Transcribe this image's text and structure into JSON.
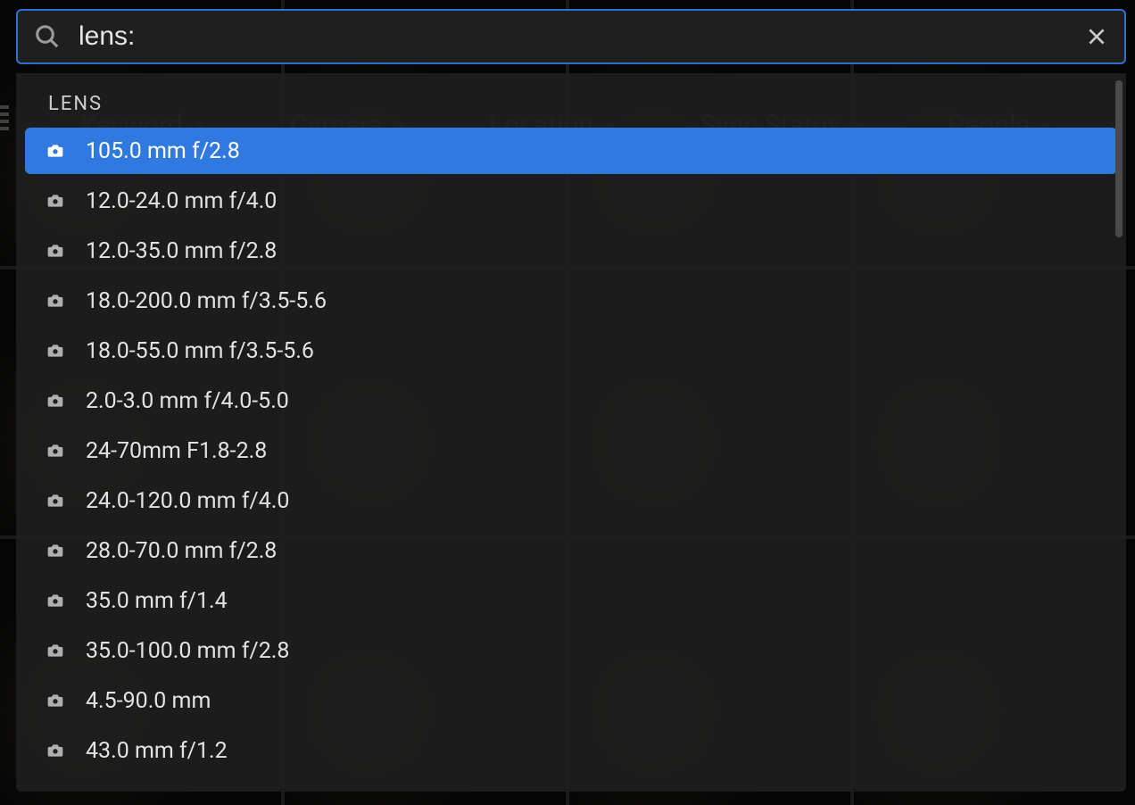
{
  "search": {
    "value": "lens:",
    "placeholder": "Search"
  },
  "filters": [
    {
      "label": "Keyword"
    },
    {
      "label": "Camera"
    },
    {
      "label": "Location"
    },
    {
      "label": "Sync Status"
    },
    {
      "label": "People"
    }
  ],
  "dropdown": {
    "section_label": "LENS",
    "items": [
      {
        "label": "105.0 mm f/2.8",
        "selected": true
      },
      {
        "label": "12.0-24.0 mm f/4.0"
      },
      {
        "label": "12.0-35.0 mm f/2.8"
      },
      {
        "label": "18.0-200.0 mm f/3.5-5.6"
      },
      {
        "label": "18.0-55.0 mm f/3.5-5.6"
      },
      {
        "label": "2.0-3.0 mm f/4.0-5.0"
      },
      {
        "label": "24-70mm F1.8-2.8"
      },
      {
        "label": "24.0-120.0 mm f/4.0"
      },
      {
        "label": "28.0-70.0 mm f/2.8"
      },
      {
        "label": "35.0 mm f/1.4"
      },
      {
        "label": "35.0-100.0 mm f/2.8"
      },
      {
        "label": "4.5-90.0 mm"
      },
      {
        "label": "43.0 mm f/1.2"
      }
    ]
  }
}
